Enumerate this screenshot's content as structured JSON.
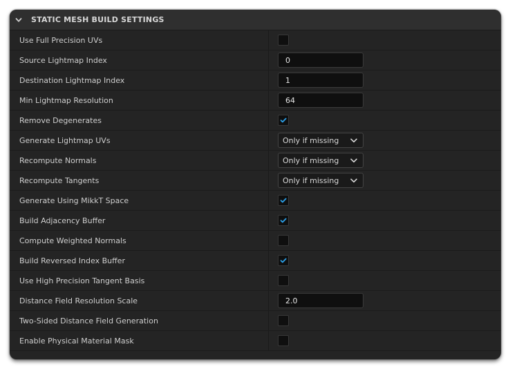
{
  "section": {
    "title": "STATIC MESH BUILD SETTINGS",
    "collapse_icon": "chevron-down-icon"
  },
  "colors": {
    "panel_bg": "#242424",
    "header_bg": "#2f2f2f",
    "check_accent": "#2ba0e8",
    "text": "#cfcfcf"
  },
  "rows": [
    {
      "label": "Use Full Precision UVs",
      "type": "checkbox",
      "checked": false
    },
    {
      "label": "Source Lightmap Index",
      "type": "number",
      "value": "0"
    },
    {
      "label": "Destination Lightmap Index",
      "type": "number",
      "value": "1"
    },
    {
      "label": "Min Lightmap Resolution",
      "type": "number",
      "value": "64"
    },
    {
      "label": "Remove Degenerates",
      "type": "checkbox",
      "checked": true
    },
    {
      "label": "Generate Lightmap UVs",
      "type": "dropdown",
      "value": "Only if missing"
    },
    {
      "label": "Recompute Normals",
      "type": "dropdown",
      "value": "Only if missing"
    },
    {
      "label": "Recompute Tangents",
      "type": "dropdown",
      "value": "Only if missing"
    },
    {
      "label": "Generate Using MikkT Space",
      "type": "checkbox",
      "checked": true
    },
    {
      "label": "Build Adjacency Buffer",
      "type": "checkbox",
      "checked": true
    },
    {
      "label": "Compute Weighted Normals",
      "type": "checkbox",
      "checked": false
    },
    {
      "label": "Build Reversed Index Buffer",
      "type": "checkbox",
      "checked": true
    },
    {
      "label": "Use High Precision Tangent Basis",
      "type": "checkbox",
      "checked": false
    },
    {
      "label": "Distance Field Resolution Scale",
      "type": "number",
      "value": "2.0"
    },
    {
      "label": "Two-Sided Distance Field Generation",
      "type": "checkbox",
      "checked": false
    },
    {
      "label": "Enable Physical Material Mask",
      "type": "checkbox",
      "checked": false
    }
  ]
}
